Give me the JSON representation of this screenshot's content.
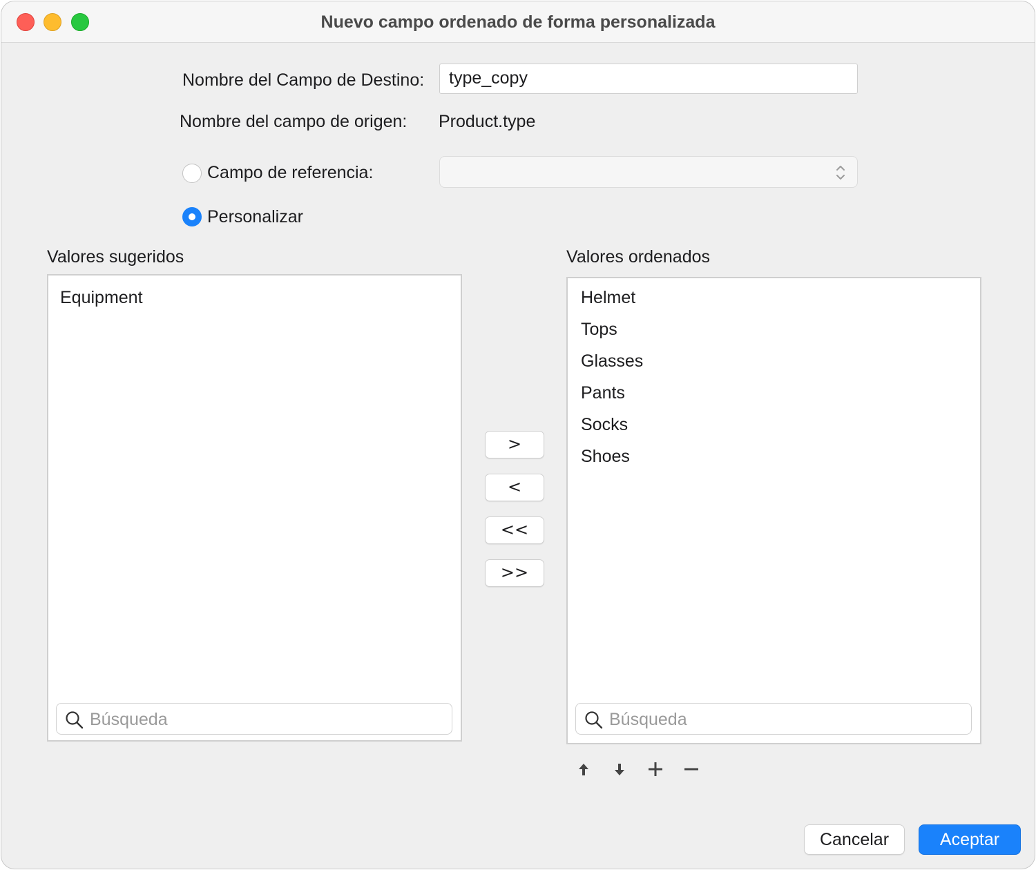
{
  "window": {
    "title": "Nuevo campo ordenado de forma personalizada"
  },
  "form": {
    "target_label": "Nombre del Campo de Destino:",
    "target_value": "type_copy",
    "source_label": "Nombre del campo de origen:",
    "source_value": "Product.type",
    "reference_label": "Campo de referencia:",
    "reference_value": "",
    "reference_selected": false,
    "custom_label": "Personalizar",
    "custom_selected": true
  },
  "suggested": {
    "heading": "Valores sugeridos",
    "items": [
      "Equipment"
    ],
    "search_placeholder": "Búsqueda"
  },
  "ordered": {
    "heading": "Valores ordenados",
    "items": [
      "Helmet",
      "Tops",
      "Glasses",
      "Pants",
      "Socks",
      "Shoes"
    ],
    "search_placeholder": "Búsqueda"
  },
  "transfer_buttons": {
    "move_right": ">",
    "move_left": "<",
    "move_all_left": "<<",
    "move_all_right": ">>"
  },
  "toolbar": {
    "icons": [
      "arrow-up-icon",
      "arrow-down-icon",
      "plus-icon",
      "minus-icon"
    ]
  },
  "footer": {
    "cancel_label": "Cancelar",
    "ok_label": "Aceptar"
  },
  "colors": {
    "accent": "#1a82fb",
    "close": "#fe5f57",
    "minimize": "#febc2e",
    "maximize": "#28c840"
  }
}
